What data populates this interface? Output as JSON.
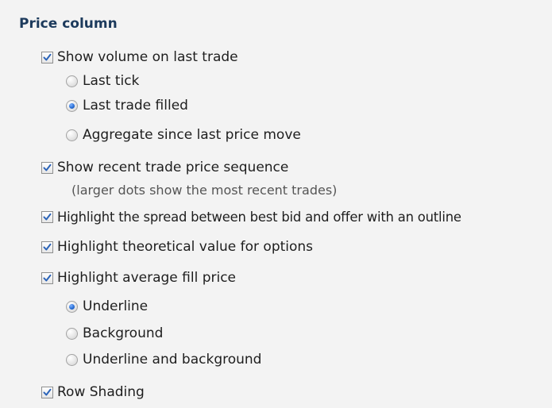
{
  "section": {
    "title": "Price column"
  },
  "options": {
    "show_volume": {
      "label": "Show volume on last trade",
      "checked": true,
      "sub": [
        {
          "label": "Last tick",
          "selected": false
        },
        {
          "label": "Last trade filled",
          "selected": true
        },
        {
          "label": "Aggregate since last price move",
          "selected": false
        }
      ]
    },
    "show_sequence": {
      "label": "Show recent trade price sequence",
      "checked": true,
      "note": "(larger dots show the most recent trades)"
    },
    "highlight_spread": {
      "label": "Highlight the spread between best bid and offer with an outline",
      "checked": true
    },
    "highlight_theoretical": {
      "label": "Highlight theoretical value for options",
      "checked": true
    },
    "highlight_avg_fill": {
      "label": "Highlight average fill price",
      "checked": true,
      "sub": [
        {
          "label": "Underline",
          "selected": true
        },
        {
          "label": "Background",
          "selected": false
        },
        {
          "label": "Underline and background",
          "selected": false
        }
      ]
    },
    "row_shading": {
      "label": "Row Shading",
      "checked": true
    }
  },
  "colors": {
    "title": "#1c3a5c",
    "check": "#2b63b8",
    "radio_dot": "#2a6fd6"
  }
}
